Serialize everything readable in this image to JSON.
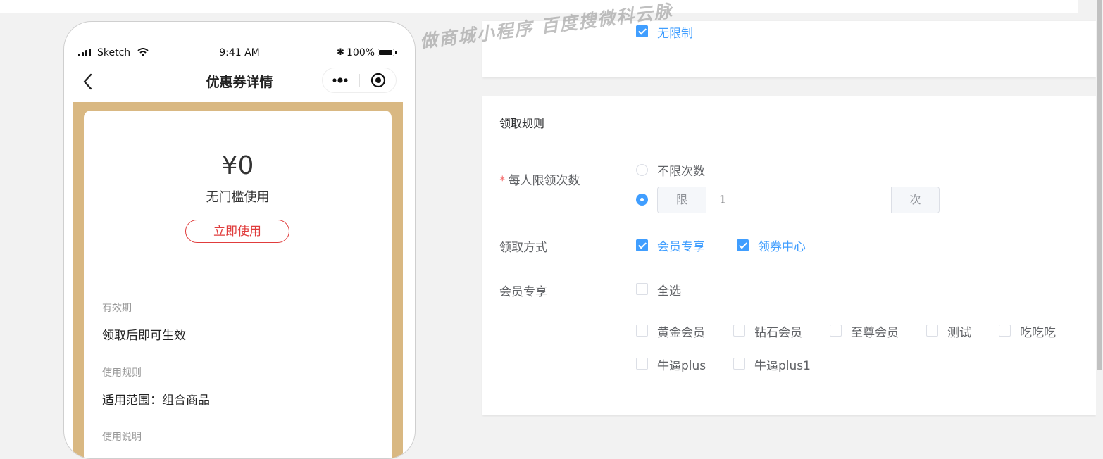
{
  "phone": {
    "status": {
      "carrier": "Sketch",
      "time": "9:41 AM",
      "battery": "100%"
    },
    "nav_title": "优惠券详情",
    "coupon": {
      "amount": "¥0",
      "threshold": "无门槛使用",
      "use_button": "立即使用",
      "validity_label": "有效期",
      "validity_value": "领取后即可生效",
      "rule_label": "使用规则",
      "rule_value": "适用范围：组合商品",
      "detail_label": "使用说明"
    },
    "accent_color": "#d9b882"
  },
  "watermark": "做商城小程序 百度搜微科云脉",
  "settings": {
    "top_option": {
      "label": "无限制",
      "checked": true
    },
    "section_title": "领取规则",
    "limit": {
      "label": "每人限领次数",
      "option_unlimited": "不限次数",
      "prepend": "限",
      "value": "1",
      "append": "次",
      "selected": "limited"
    },
    "method": {
      "label": "领取方式",
      "options": [
        {
          "label": "会员专享",
          "checked": true
        },
        {
          "label": "领券中心",
          "checked": true
        }
      ]
    },
    "members": {
      "label": "会员专享",
      "select_all": "全选",
      "options": [
        "黄金会员",
        "钻石会员",
        "至尊会员",
        "测试",
        "吃吃吃",
        "牛逼plus",
        "牛逼plus1"
      ]
    },
    "primary_color": "#409eff"
  }
}
